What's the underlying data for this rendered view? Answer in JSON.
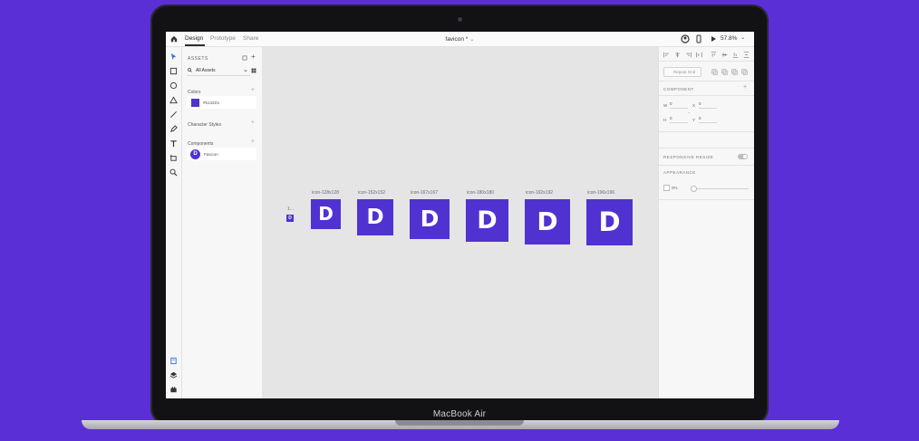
{
  "device": {
    "brand": "MacBook Air"
  },
  "app": {
    "tabs": [
      {
        "label": "Design",
        "active": true
      },
      {
        "label": "Prototype",
        "active": false
      },
      {
        "label": "Share",
        "active": false
      }
    ],
    "document_title": "favicon *",
    "zoom": "57.8%"
  },
  "assets": {
    "header": "ASSETS",
    "filter": "All Assets",
    "colors_label": "Colors",
    "color_value": "#5132D1",
    "character_styles_label": "Character Styles",
    "components_label": "Components",
    "component_name": "Favicon",
    "component_letter": "D"
  },
  "canvas": {
    "small_artboard_label": "1...",
    "small_artboard_letter": "D",
    "artboards": [
      {
        "label": "icon-128x128",
        "letter": "D"
      },
      {
        "label": "icon-152x152",
        "letter": "D"
      },
      {
        "label": "icon-167x167",
        "letter": "D"
      },
      {
        "label": "icon-180x180",
        "letter": "D"
      },
      {
        "label": "icon-192x192",
        "letter": "D"
      },
      {
        "label": "icon-196x196",
        "letter": "D"
      }
    ]
  },
  "properties": {
    "repeat_grid": "Repeat Grid",
    "component": "COMPONENT",
    "w_label": "W",
    "w_value": "0",
    "x_label": "X",
    "x_value": "0",
    "h_label": "H",
    "h_value": "0",
    "y_label": "Y",
    "y_value": "0",
    "responsive_resize": "RESPONSIVE RESIZE",
    "appearance": "APPEARANCE",
    "opacity": "0%"
  },
  "colors": {
    "brand": "#5032d1",
    "background": "#5b2fd6"
  }
}
